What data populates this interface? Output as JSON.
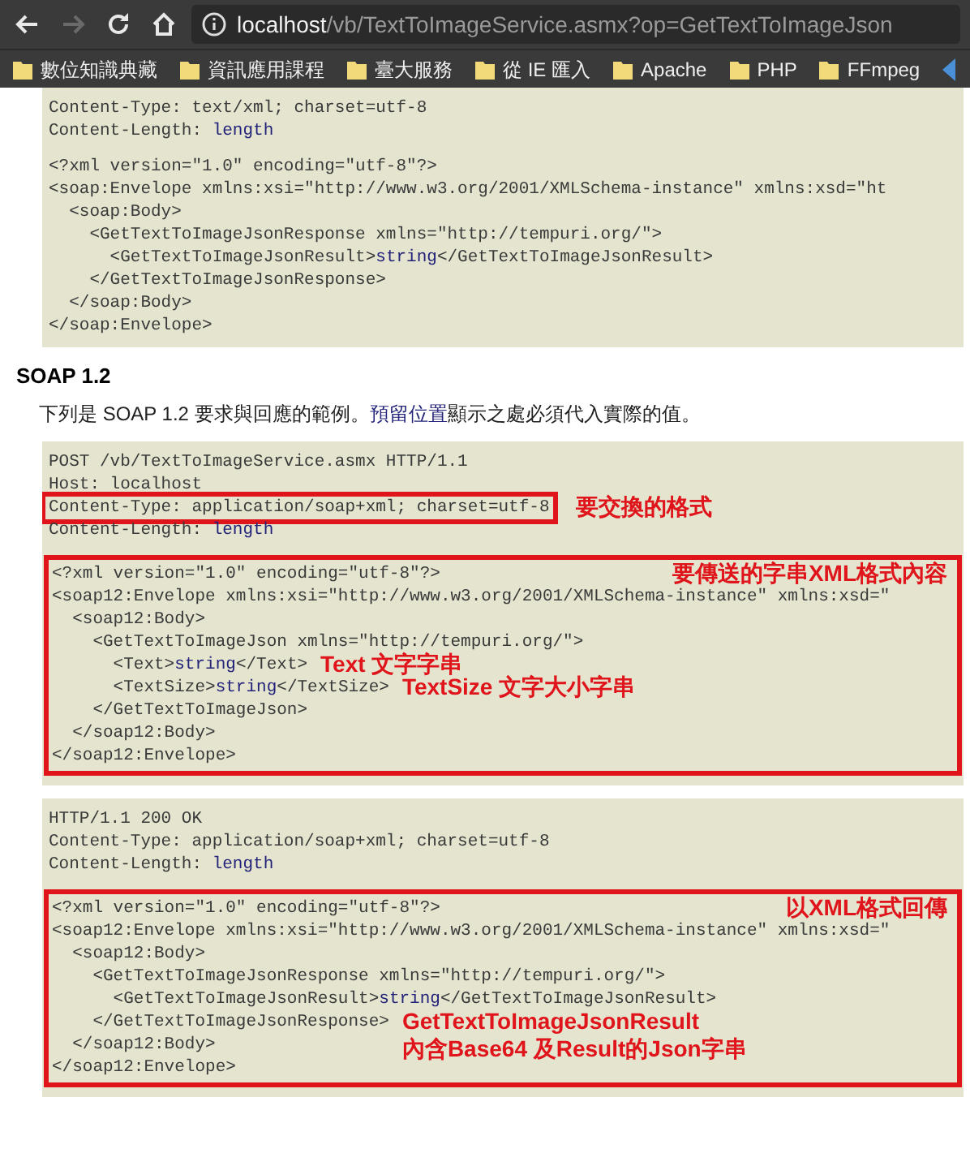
{
  "nav_buttons": [
    {
      "kind": "back",
      "disabled": false
    },
    {
      "kind": "forward",
      "disabled": true
    },
    {
      "kind": "reload",
      "disabled": false
    },
    {
      "kind": "home",
      "disabled": false
    }
  ],
  "address_bar": {
    "host": "localhost",
    "path": "/vb/TextToImageService.asmx?op=GetTextToImageJson"
  },
  "bookmarks": [
    {
      "kind": "folder",
      "label": "數位知識典藏"
    },
    {
      "kind": "folder",
      "label": "資訊應用課程"
    },
    {
      "kind": "folder",
      "label": "臺大服務"
    },
    {
      "kind": "folder",
      "label": "從 IE 匯入"
    },
    {
      "kind": "folder",
      "label": "Apache"
    },
    {
      "kind": "folder",
      "label": "PHP"
    },
    {
      "kind": "folder",
      "label": "FFmpeg"
    },
    {
      "kind": "app"
    }
  ],
  "page": [
    {
      "kind": "code_block",
      "groups": [
        {
          "boxed": false,
          "lines": [
            {
              "segments": [
                {
                  "text": "Content-Type: text/xml; charset=utf-8"
                }
              ]
            },
            {
              "segments": [
                {
                  "text": "Content-Length: "
                },
                {
                  "text": "length",
                  "kind": "placeholder"
                }
              ]
            }
          ]
        },
        {
          "boxed": false,
          "lines": [
            {
              "segments": [
                {
                  "text": "<?xml version=\"1.0\" encoding=\"utf-8\"?>"
                }
              ]
            },
            {
              "segments": [
                {
                  "text": "<soap:Envelope xmlns:xsi=\"http://www.w3.org/2001/XMLSchema-instance\" xmlns:xsd=\"ht"
                }
              ]
            },
            {
              "segments": [
                {
                  "text": "  <soap:Body>"
                }
              ]
            },
            {
              "segments": [
                {
                  "text": "    <GetTextToImageJsonResponse xmlns=\"http://tempuri.org/\">"
                }
              ]
            },
            {
              "segments": [
                {
                  "text": "      <GetTextToImageJsonResult>"
                },
                {
                  "text": "string",
                  "kind": "placeholder"
                },
                {
                  "text": "</GetTextToImageJsonResult>"
                }
              ]
            },
            {
              "segments": [
                {
                  "text": "    </GetTextToImageJsonResponse>"
                }
              ]
            },
            {
              "segments": [
                {
                  "text": "  </soap:Body>"
                }
              ]
            },
            {
              "segments": [
                {
                  "text": "</soap:Envelope>"
                }
              ]
            }
          ]
        }
      ]
    },
    {
      "kind": "heading",
      "text": "SOAP 1.2"
    },
    {
      "kind": "paragraph",
      "parts": [
        {
          "text": "下列是 SOAP 1.2 要求與回應的範例。"
        },
        {
          "text": "預留位置",
          "kind": "placeholder"
        },
        {
          "text": "顯示之處必須代入實際的值。"
        }
      ]
    },
    {
      "kind": "code_block",
      "groups": [
        {
          "boxed": false,
          "lines": [
            {
              "segments": [
                {
                  "text": "POST /vb/TextToImageService.asmx HTTP/1.1"
                }
              ]
            },
            {
              "segments": [
                {
                  "text": "Host: localhost"
                }
              ]
            },
            {
              "segments": [
                {
                  "text": "Content-Type: application/soap+xml; charset=utf-8"
                }
              ],
              "boxed": true,
              "note": [
                "要交換的格式"
              ]
            },
            {
              "segments": [
                {
                  "text": "Content-Length: "
                },
                {
                  "text": "length",
                  "kind": "placeholder"
                }
              ]
            }
          ]
        },
        {
          "boxed": true,
          "note": "要傳送的字串XML格式內容",
          "lines": [
            {
              "segments": [
                {
                  "text": "<?xml version=\"1.0\" encoding=\"utf-8\"?>"
                }
              ]
            },
            {
              "segments": [
                {
                  "text": "<soap12:Envelope xmlns:xsi=\"http://www.w3.org/2001/XMLSchema-instance\" xmlns:xsd=\""
                }
              ]
            },
            {
              "segments": [
                {
                  "text": "  <soap12:Body>"
                }
              ]
            },
            {
              "segments": [
                {
                  "text": "    <GetTextToImageJson xmlns=\"http://tempuri.org/\">"
                }
              ]
            },
            {
              "segments": [
                {
                  "text": "      <Text>"
                },
                {
                  "text": "string",
                  "kind": "placeholder"
                },
                {
                  "text": "</Text>"
                }
              ],
              "note": [
                "Text 文字字串"
              ]
            },
            {
              "segments": [
                {
                  "text": "      <TextSize>"
                },
                {
                  "text": "string",
                  "kind": "placeholder"
                },
                {
                  "text": "</TextSize>"
                }
              ],
              "note": [
                "TextSize 文字大小字串"
              ]
            },
            {
              "segments": [
                {
                  "text": "    </GetTextToImageJson>"
                }
              ]
            },
            {
              "segments": [
                {
                  "text": "  </soap12:Body>"
                }
              ]
            },
            {
              "segments": [
                {
                  "text": "</soap12:Envelope>"
                }
              ]
            }
          ]
        }
      ]
    },
    {
      "kind": "code_block",
      "groups": [
        {
          "boxed": false,
          "lines": [
            {
              "segments": [
                {
                  "text": "HTTP/1.1 200 OK"
                }
              ]
            },
            {
              "segments": [
                {
                  "text": "Content-Type: application/soap+xml; charset=utf-8"
                }
              ]
            },
            {
              "segments": [
                {
                  "text": "Content-Length: "
                },
                {
                  "text": "length",
                  "kind": "placeholder"
                }
              ]
            }
          ]
        },
        {
          "boxed": true,
          "note": "以XML格式回傳",
          "lines": [
            {
              "segments": [
                {
                  "text": "<?xml version=\"1.0\" encoding=\"utf-8\"?>"
                }
              ]
            },
            {
              "segments": [
                {
                  "text": "<soap12:Envelope xmlns:xsi=\"http://www.w3.org/2001/XMLSchema-instance\" xmlns:xsd=\""
                }
              ]
            },
            {
              "segments": [
                {
                  "text": "  <soap12:Body>"
                }
              ]
            },
            {
              "segments": [
                {
                  "text": "    <GetTextToImageJsonResponse xmlns=\"http://tempuri.org/\">"
                }
              ]
            },
            {
              "segments": [
                {
                  "text": "      <GetTextToImageJsonResult>"
                },
                {
                  "text": "string",
                  "kind": "placeholder"
                },
                {
                  "text": "</GetTextToImageJsonResult>"
                }
              ]
            },
            {
              "segments": [
                {
                  "text": "    </GetTextToImageJsonResponse>"
                }
              ],
              "note": [
                "GetTextToImageJsonResult",
                "內含Base64 及Result的Json字串"
              ]
            },
            {
              "segments": [
                {
                  "text": "  </soap12:Body>"
                }
              ]
            },
            {
              "segments": [
                {
                  "text": "</soap12:Envelope>"
                }
              ]
            }
          ]
        }
      ]
    }
  ]
}
